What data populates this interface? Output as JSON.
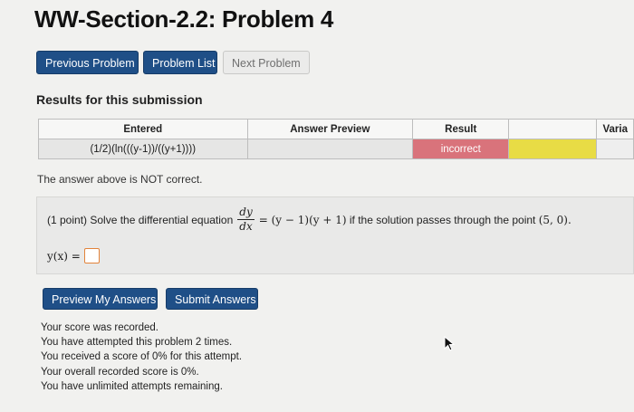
{
  "page": {
    "title": "WW-Section-2.2: Problem 4"
  },
  "nav": {
    "previous": "Previous Problem",
    "list": "Problem List",
    "next": "Next Problem"
  },
  "results": {
    "heading": "Results for this submission",
    "columns": {
      "entered": "Entered",
      "preview": "Answer Preview",
      "result": "Result",
      "message": "",
      "variable": "Varia"
    },
    "row": {
      "entered": "(1/2)(ln(((y-1))/((y+1))))",
      "preview": "",
      "result": "incorrect",
      "message": ""
    },
    "status_message": "The answer above is NOT correct."
  },
  "problem": {
    "points": "(1 point)",
    "intro": "Solve the differential equation",
    "frac_num": "dy",
    "frac_den": "dx",
    "equation_rhs": "= (y − 1)(y + 1)",
    "condition_text": "if the solution passes through the point",
    "point": "(5, 0).",
    "answer_label": "y(x) =",
    "answer_value": ""
  },
  "actions": {
    "preview": "Preview My Answers",
    "submit": "Submit Answers"
  },
  "score": {
    "lines": [
      "Your score was recorded.",
      "You have attempted this problem 2 times.",
      "You received a score of 0% for this attempt.",
      "Your overall recorded score is 0%.",
      "You have unlimited attempts remaining."
    ]
  },
  "colors": {
    "primary_button": "#1f4f87",
    "incorrect": "#d9737b",
    "message_cell": "#e8dc45",
    "input_border": "#e2833a"
  }
}
